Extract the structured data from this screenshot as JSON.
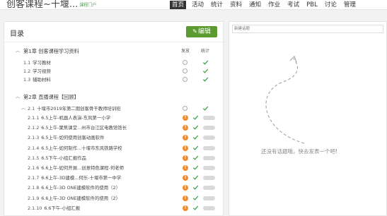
{
  "header": {
    "title": "创客课程~十堰...",
    "subtitle": "课程门户",
    "nav": [
      "首页",
      "活动",
      "统计",
      "资料",
      "通知",
      "作业",
      "考试",
      "PBL",
      "讨论",
      "管理"
    ],
    "active_index": 0
  },
  "outline": {
    "title": "目录",
    "edit_label": "编辑",
    "col_publish": "发放",
    "col_stats": "统计",
    "chapters": [
      {
        "title": "第1章 创客课程学习资料",
        "items": [
          {
            "num": "1.1",
            "label": "学习教材"
          },
          {
            "num": "1.2",
            "label": "学习视频"
          },
          {
            "num": "1.3",
            "label": "辅助材料"
          }
        ]
      },
      {
        "title": "第2章 直播课程【回顾】",
        "section": {
          "num": "2.1",
          "label": "十堰市2019年第二期创客骨干教师培训班"
        },
        "items": [
          {
            "num": "2.1.1",
            "label": "6.5上午-机器人表演-东风第一小学"
          },
          {
            "num": "2.1.2",
            "label": "6.5上午-聚焦课堂...州市台江区电教馆馆长"
          },
          {
            "num": "2.1.3",
            "label": "6.5上午-如何使用创客动画软件"
          },
          {
            "num": "2.1.4",
            "label": "6.5上午-如何制作...十堰市东风铁路学校"
          },
          {
            "num": "2.1.5",
            "label": "6.5下午-小组汇报作品"
          },
          {
            "num": "2.1.6",
            "label": "6.6上午-如何开展...创意特色课程-何老师"
          },
          {
            "num": "2.1.7",
            "label": "6.6上午-3D建模...何乐-十堰市第一中学"
          },
          {
            "num": "2.1.8",
            "label": "6.6上午-3D ONE建模软件的使用（2）"
          },
          {
            "num": "2.1.9",
            "label": "6.6上午-3D ONE建模软件的使用（2）"
          },
          {
            "num": "2.1.10",
            "label": "6.6下午-小组汇报"
          }
        ]
      }
    ]
  },
  "discussion": {
    "input_placeholder": "新建话题",
    "empty_message": "还没有话题哦，快去发表一个吧!"
  },
  "colors": {
    "accent_green": "#5a9a2f",
    "check_green": "#3aa344",
    "warn_orange": "#f08a2c",
    "nav_active_bg": "#333333"
  }
}
